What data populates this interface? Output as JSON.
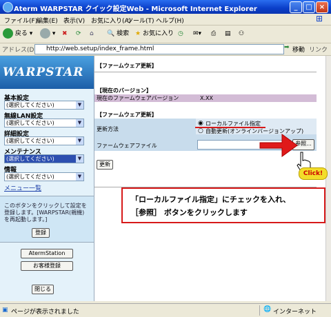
{
  "window": {
    "title": "Aterm WARPSTAR クイック設定Web - Microsoft Internet Explorer"
  },
  "menu": [
    "ファイル(F)",
    "編集(E)",
    "表示(V)",
    "お気に入り(A)",
    "ツール(T)",
    "ヘルプ(H)"
  ],
  "toolbar": {
    "back": "戻る",
    "search": "検索",
    "favorites": "お気に入り"
  },
  "address": {
    "label": "アドレス(D)",
    "url": "http://web.setup/index_frame.html",
    "go": "移動",
    "links": "リンク"
  },
  "sidebar": {
    "logo": "WARPSTAR",
    "sections": [
      {
        "label": "基本設定",
        "select": "(選択してください)"
      },
      {
        "label": "無線LAN設定",
        "select": "(選択してください)"
      },
      {
        "label": "詳細設定",
        "select": "(選択してください)"
      },
      {
        "label": "メンテナンス",
        "select": "(選択してください)"
      },
      {
        "label": "情報",
        "select": "(選択してください)"
      }
    ],
    "menu_list": "メニュー一覧",
    "save_note": "このボタンをクリックして設定を登録します。[WARPSTAR(親機)を再起動します。]",
    "save_button": "登録",
    "atermstation": "AtermStation",
    "customer_register": "お客様登録",
    "close_button": "閉じる"
  },
  "main": {
    "page_title": "【ファームウェア更新】",
    "current_version_heading": "【現在のバージョン】",
    "current_version_label": "現在のファームウェアバージョン",
    "current_version_value": "X.XX",
    "update_heading": "【ファームウェア更新】",
    "method_label": "更新方法",
    "option_local": "ローカルファイル指定",
    "option_online": "自動更新(オンラインバージョンアップ)",
    "file_label": "ファームウェアファイル",
    "browse_button": "参照...",
    "update_button": "更新",
    "click_label": "Click!"
  },
  "callout": {
    "line1": "「ローカルファイル指定」にチェックを入れ、",
    "line2": "［参照］ ボタンをクリックします"
  },
  "status": {
    "left": "ページが表示されました",
    "zone": "インターネット"
  }
}
